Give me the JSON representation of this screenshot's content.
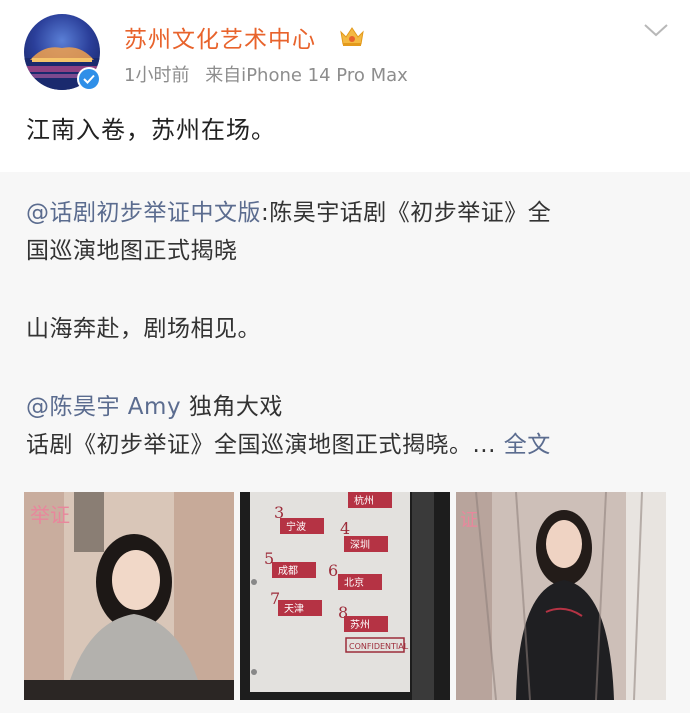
{
  "post": {
    "user_name": "苏州文化艺术中心",
    "time_ago": "1小时前",
    "source": "来自iPhone 14 Pro Max",
    "text": "江南入卷，苏州在场。"
  },
  "repost": {
    "mention_1": "@话剧初步举证中文版",
    "line_1_rest": ":陈昊宇话剧《初步举证》全",
    "line_2": "国巡演地图正式揭晓",
    "line_3": "山海奔赴，剧场相见。",
    "mention_2": "@陈昊宇 Amy",
    "line_4_rest": " 独角大戏",
    "line_5": "话剧《初步举证》全国巡演地图正式揭晓。...",
    "full_text_link": "全文"
  },
  "photos": [
    {
      "alt": "photo-1"
    },
    {
      "map_cities": [
        "杭州",
        "宁波",
        "深圳",
        "成都",
        "北京",
        "天津",
        "苏州"
      ],
      "map_numbers": [
        "3",
        "4",
        "5",
        "6",
        "7",
        "8"
      ],
      "stamp": "CONFIDENTIAL"
    },
    {
      "alt": "photo-3"
    }
  ],
  "icons": {
    "crown": "crown-icon",
    "chevron": "chevron-down-icon",
    "verified": "verified-icon"
  },
  "colors": {
    "name": "#e8632c",
    "link": "#5b6c8f",
    "meta": "#8d8d8d",
    "repost_bg": "#f7f7f7",
    "verified": "#2f8fe8"
  }
}
